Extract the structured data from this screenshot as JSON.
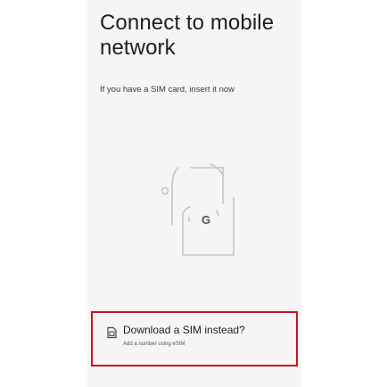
{
  "page": {
    "title": "Connect to mobile network",
    "subtitle": "If you have a SIM card, insert it now"
  },
  "illustration": {
    "icon": "phone-sim-illustration",
    "brand_mark": "G"
  },
  "download_option": {
    "icon": "esim-icon",
    "title": "Download a SIM instead?",
    "subtitle": "Add a number using eSIM"
  },
  "colors": {
    "background": "#f6f4f4",
    "text": "#1f1f1f",
    "highlight": "#c8141e",
    "line": "#c8c8cc"
  }
}
